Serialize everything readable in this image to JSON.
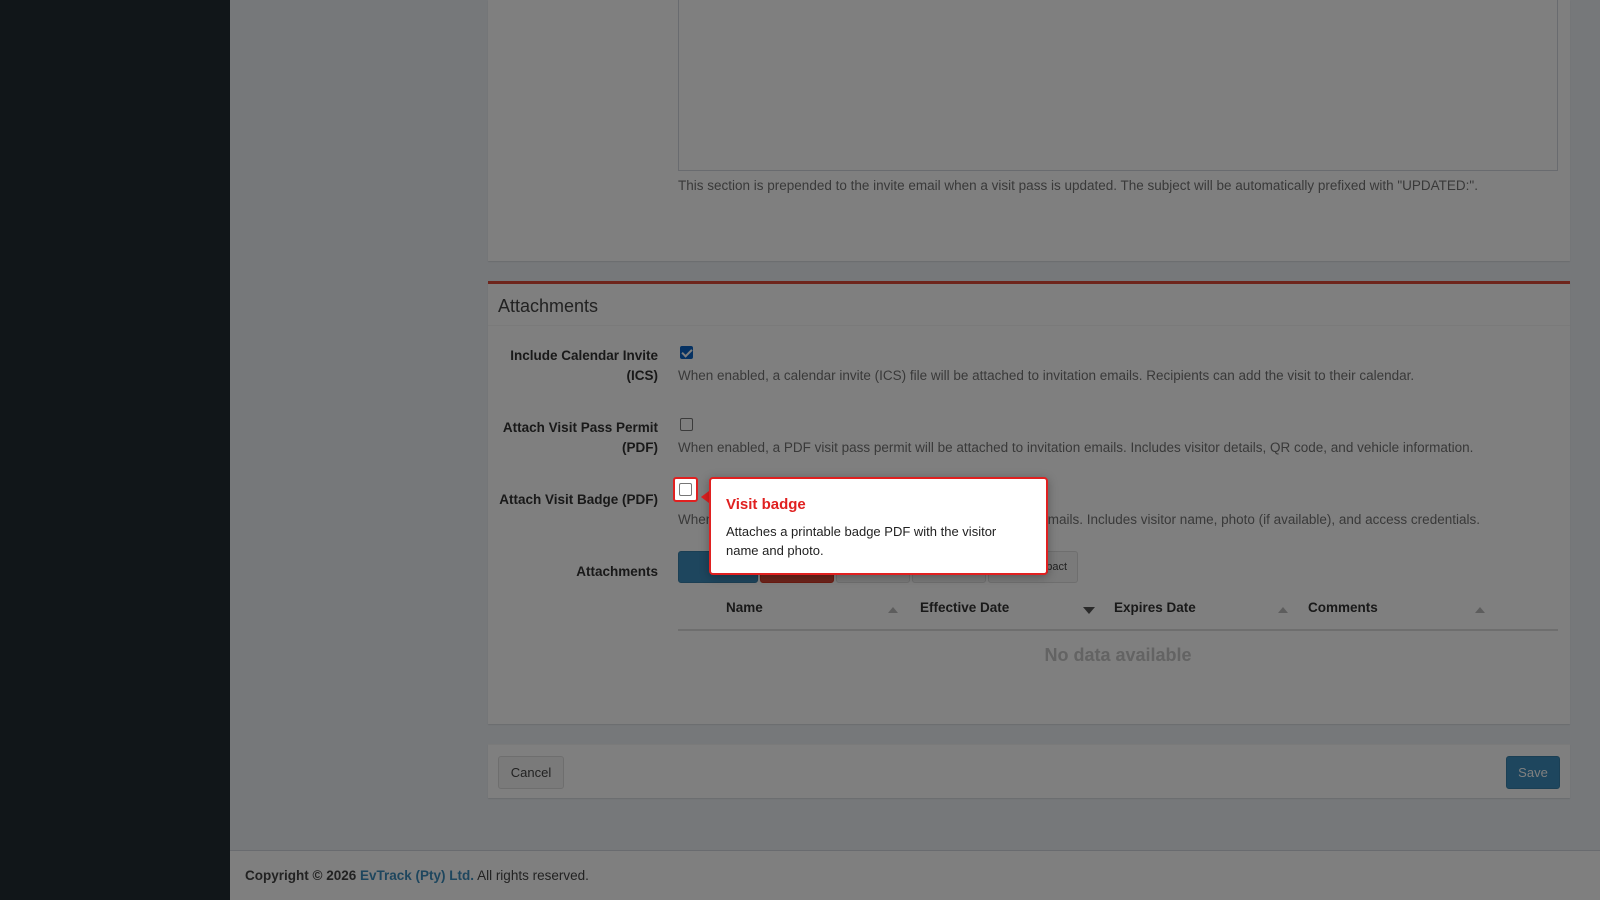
{
  "email_section": {
    "help_text": "This section is prepended to the invite email when a visit pass is updated. The subject will be automatically prefixed with \"UPDATED:\"."
  },
  "attachments_section": {
    "title": "Attachments",
    "fields": [
      {
        "label_line1": "Include Calendar Invite",
        "label_line2": "(ICS)",
        "checked": true,
        "help": "When enabled, a calendar invite (ICS) file will be attached to invitation emails. Recipients can add the visit to their calendar."
      },
      {
        "label_line1": "Attach Visit Pass Permit",
        "label_line2": "(PDF)",
        "checked": false,
        "help": "When enabled, a PDF visit pass permit will be attached to invitation emails. Includes visitor details, QR code, and vehicle information."
      },
      {
        "label": "Attach Visit Badge (PDF)",
        "checked": false,
        "help_visible_start": "When",
        "help_visible_end": "n emails. Includes visitor name, photo (if available), and access credentials."
      }
    ],
    "attachments_label": "Attachments",
    "toolbar": {
      "upload_icon": "upload-icon",
      "last_button_partial": "pact"
    },
    "table": {
      "columns": [
        "Name",
        "Effective Date",
        "Expires Date",
        "Comments"
      ],
      "empty_text": "No data available"
    }
  },
  "footer_buttons": {
    "cancel": "Cancel",
    "save": "Save"
  },
  "page_footer": {
    "copyright": "Copyright © 2026",
    "company": "EvTrack (Pty) Ltd.",
    "rights": "All rights reserved."
  },
  "tooltip": {
    "title": "Visit badge",
    "text": "Attaches a printable badge PDF with the visitor name and photo."
  },
  "colors": {
    "accent": "#3c8dbc",
    "danger": "#dd4b39",
    "tooltip_border": "#e02020",
    "sidebar": "#222d32"
  }
}
